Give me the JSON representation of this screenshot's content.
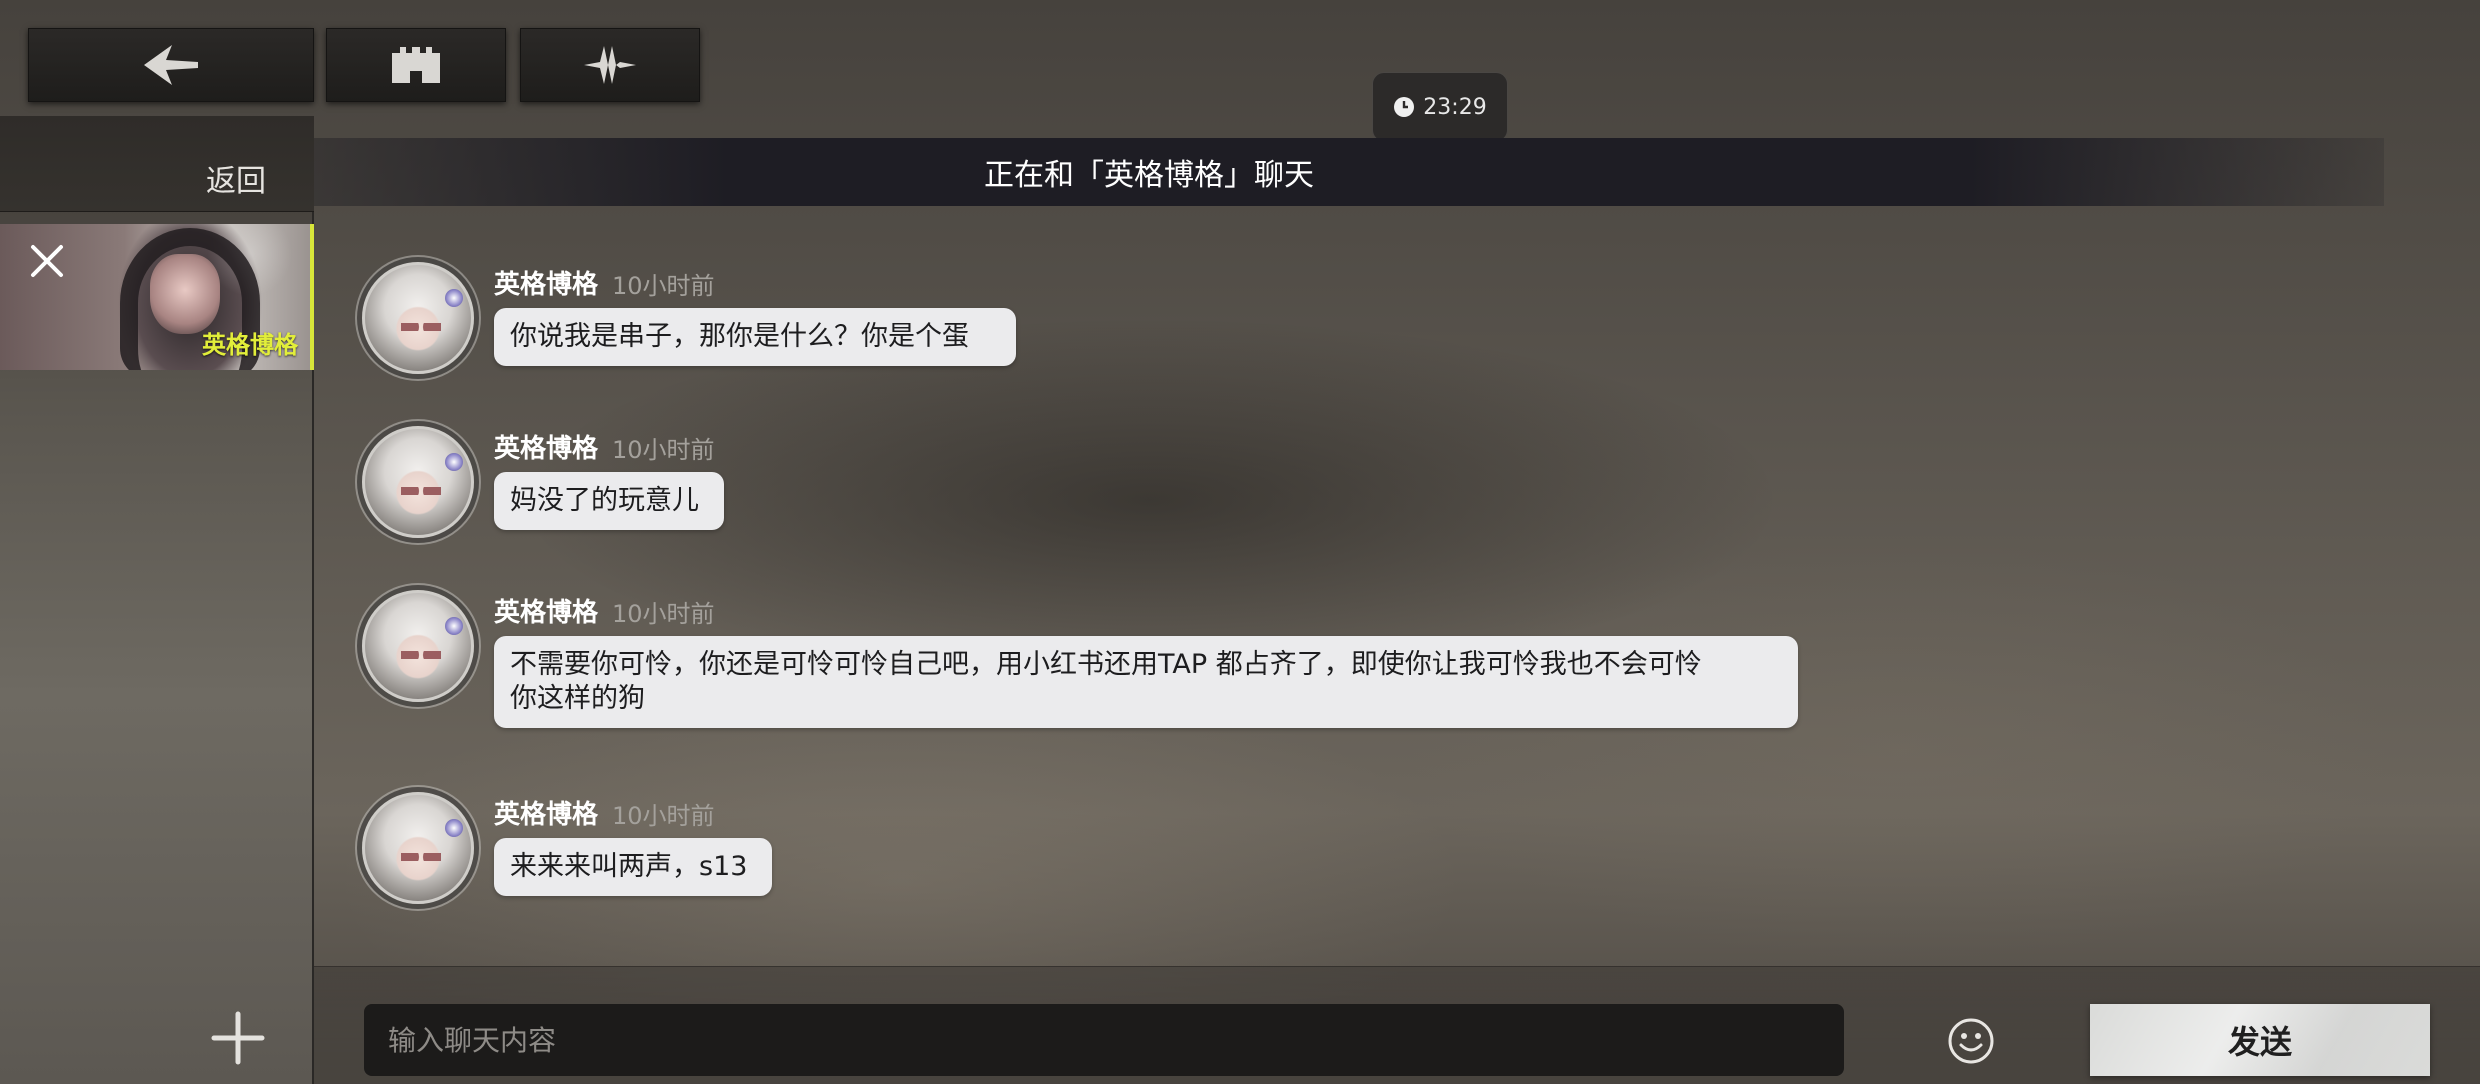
{
  "top_nav": {
    "back_icon": "arrow-back-icon",
    "home_icon": "castle-icon",
    "wave_icon": "waveform-icon"
  },
  "sidebar": {
    "back_label": "返回",
    "contact": {
      "name": "英格博格",
      "selected": true,
      "accent_color": "#d8e63a"
    }
  },
  "status": {
    "time": "23:29"
  },
  "chat": {
    "title": "正在和「英格博格」聊天",
    "messages": [
      {
        "sender": "英格博格",
        "time": "10小时前",
        "text": "你说我是串子，那你是什么？你是个蛋"
      },
      {
        "sender": "英格博格",
        "time": "10小时前",
        "text": "妈没了的玩意儿"
      },
      {
        "sender": "英格博格",
        "time": "10小时前",
        "line1": "不需要你可怜，你还是可怜可怜自己吧，用小红书还用TAP 都占齐了，即使你让我可怜我也不会可怜",
        "line2": "你这样的狗"
      },
      {
        "sender": "英格博格",
        "time": "10小时前",
        "text": "来来来叫两声，s13"
      }
    ]
  },
  "composer": {
    "placeholder": "输入聊天内容",
    "value": "",
    "send_label": "发送"
  }
}
